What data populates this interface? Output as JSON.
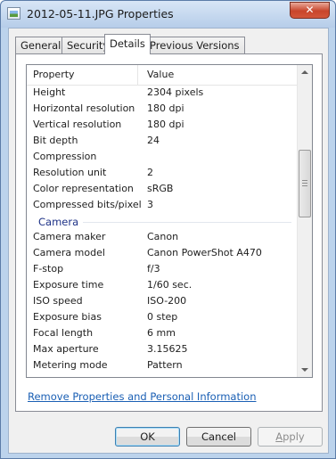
{
  "window": {
    "title": "2012-05-11.JPG Properties",
    "close_glyph": "✕"
  },
  "tabs": [
    {
      "label": "General"
    },
    {
      "label": "Security"
    },
    {
      "label": "Details"
    },
    {
      "label": "Previous Versions"
    }
  ],
  "details": {
    "col_property": "Property",
    "col_value": "Value",
    "rows_top": [
      {
        "k": "Height",
        "v": "2304 pixels"
      },
      {
        "k": "Horizontal resolution",
        "v": "180 dpi"
      },
      {
        "k": "Vertical resolution",
        "v": "180 dpi"
      },
      {
        "k": "Bit depth",
        "v": "24"
      },
      {
        "k": "Compression",
        "v": ""
      },
      {
        "k": "Resolution unit",
        "v": "2"
      },
      {
        "k": "Color representation",
        "v": "sRGB"
      },
      {
        "k": "Compressed bits/pixel",
        "v": "3"
      }
    ],
    "group_camera": "Camera",
    "rows_camera": [
      {
        "k": "Camera maker",
        "v": "Canon"
      },
      {
        "k": "Camera model",
        "v": "Canon PowerShot A470"
      },
      {
        "k": "F-stop",
        "v": "f/3"
      },
      {
        "k": "Exposure time",
        "v": "1/60 sec."
      },
      {
        "k": "ISO speed",
        "v": "ISO-200"
      },
      {
        "k": "Exposure bias",
        "v": "0 step"
      },
      {
        "k": "Focal length",
        "v": "6 mm"
      },
      {
        "k": "Max aperture",
        "v": "3.15625"
      },
      {
        "k": "Metering mode",
        "v": "Pattern"
      }
    ],
    "remove_link": "Remove Properties and Personal Information"
  },
  "buttons": {
    "ok": "OK",
    "cancel": "Cancel",
    "apply_first": "A",
    "apply_rest": "pply"
  }
}
